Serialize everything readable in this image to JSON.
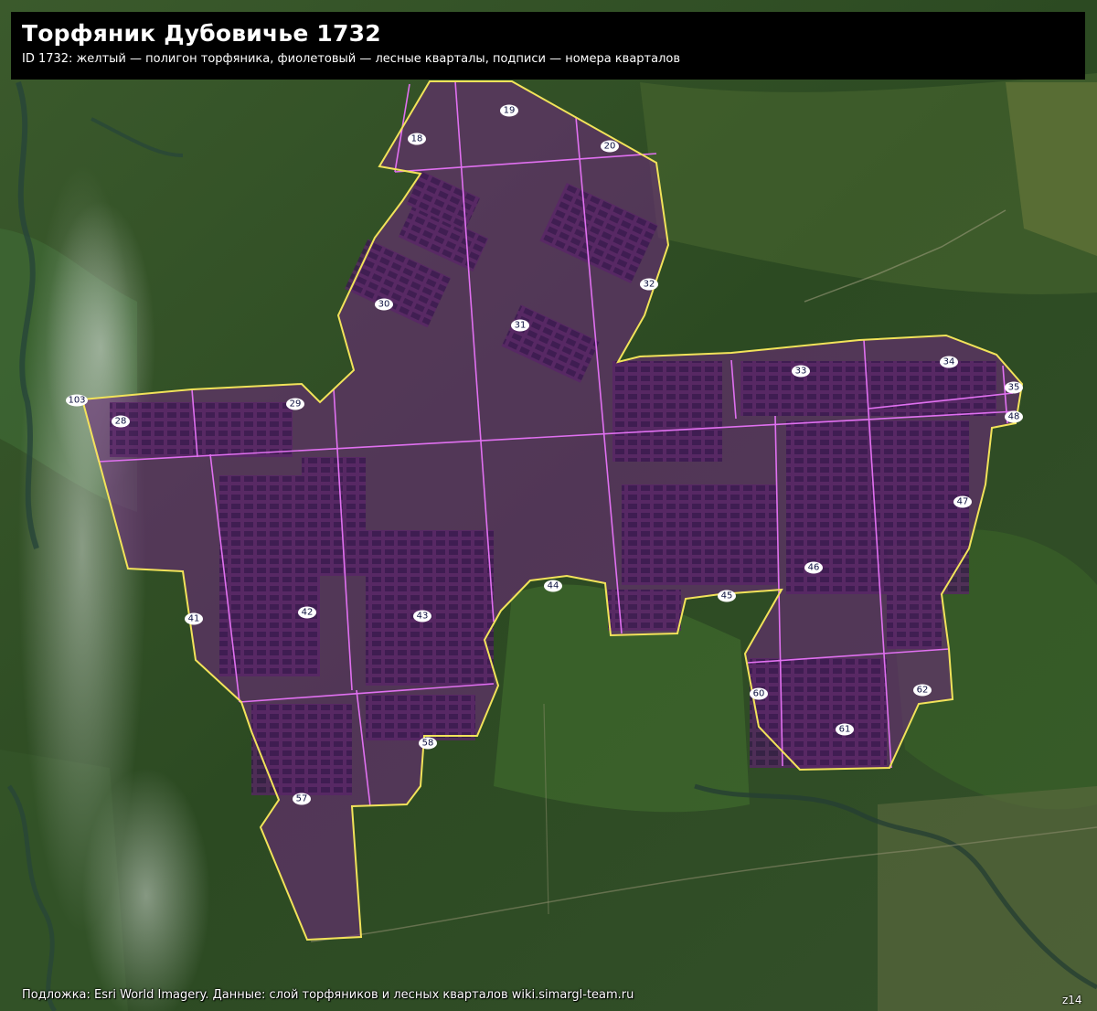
{
  "title": "Торфяник Дубовичье 1732",
  "subtitle": "ID 1732: желтый — полигон торфяника, фиолетовый — лесные кварталы, подписи — номера кварталов",
  "attribution": "Подложка: Esri World Imagery. Данные: слой торфяников и лесных кварталов wiki.simargl-team.ru",
  "zoom": "z14",
  "colors": {
    "peatland_outline": "#f2e35a",
    "quarter_lines": "#e070f0",
    "peat_fill": "#6b2a7a",
    "label_bg": "#ffffff",
    "label_text": "#0d1140"
  },
  "quarters": [
    "18",
    "19",
    "20",
    "28",
    "29",
    "30",
    "31",
    "32",
    "33",
    "34",
    "35",
    "41",
    "42",
    "43",
    "44",
    "45",
    "46",
    "47",
    "48",
    "57",
    "58",
    "60",
    "61",
    "62",
    "103"
  ]
}
